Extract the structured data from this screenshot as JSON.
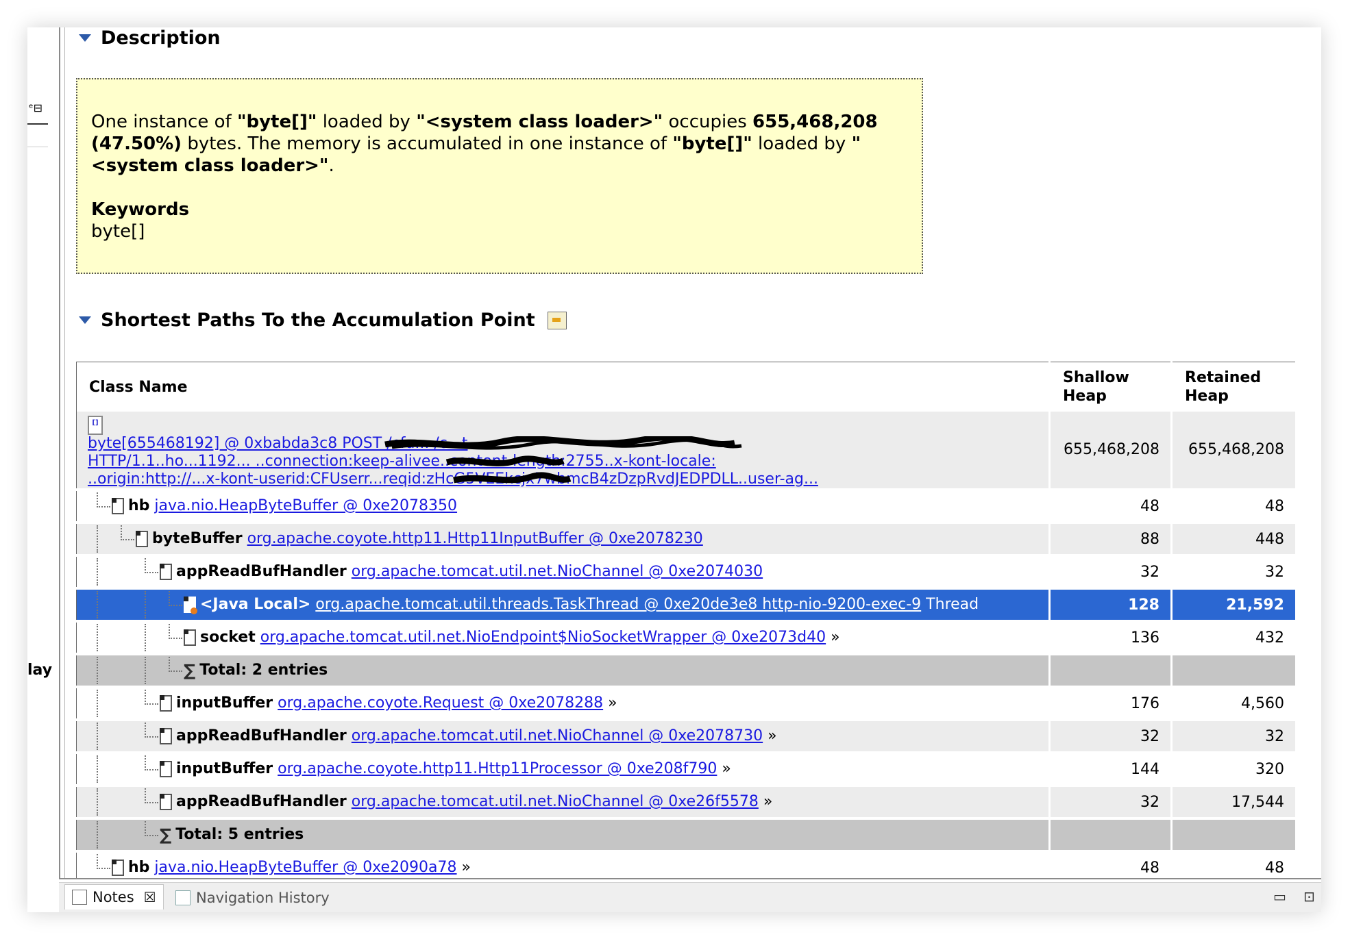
{
  "sidebar": {
    "fragment_icon": "ᵉ⊟",
    "fragment_text": "lay"
  },
  "description": {
    "title": "Description",
    "p1": "One instance of ",
    "p1_b1": "\"byte[]\"",
    "p1_t2": " loaded by ",
    "p1_b2": "\"<system class loader>\"",
    "p1_t3": " occupies ",
    "p1_b3": "655,468,208 (47.50%)",
    "p1_t4": " bytes. The memory is accumulated in one instance of ",
    "p1_b4": "\"byte[]\"",
    "p1_t5": " loaded by ",
    "p1_b5": "\"<system class loader>\"",
    "p1_t6": ".",
    "keywords_label": "Keywords",
    "keywords_value": "byte[]"
  },
  "paths": {
    "title": "Shortest Paths To the Accumulation Point"
  },
  "table": {
    "headers": {
      "class_name": "Class Name",
      "shallow": "Shallow Heap",
      "retained": "Retained Heap"
    },
    "root": {
      "line1": "byte[655468192] @ 0xbabda3c8 POST /cfu... /c...t",
      "line2": "HTTP/1.1..ho...1192... ..connection:keep-alivee..content-length:2755..x-kont-locale:",
      "line3": "..origin:http://...x-kont-userid:CFUserr...reqid:zHcG5VEEkcjx7wbmcB4zDzpRvdJEDPDLL..user-ag...",
      "shallow": "655,468,208",
      "retained": "655,468,208"
    },
    "rows": [
      {
        "field": "hb",
        "link": "java.nio.HeapByteBuffer @ 0xe2078350",
        "suffix": "",
        "shallow": "48",
        "retained": "48"
      },
      {
        "field": "byteBuffer",
        "link": "org.apache.coyote.http11.Http11InputBuffer @ 0xe2078230",
        "suffix": "",
        "shallow": "88",
        "retained": "448"
      },
      {
        "field": "appReadBufHandler",
        "link": "org.apache.tomcat.util.net.NioChannel @ 0xe2074030",
        "suffix": "",
        "shallow": "32",
        "retained": "32"
      },
      {
        "field": "<Java Local>",
        "link": "org.apache.tomcat.util.threads.TaskThread @ 0xe20de3e8 http-nio-9200-exec-9",
        "suffix": " Thread",
        "shallow": "128",
        "retained": "21,592"
      },
      {
        "field": "socket",
        "link": "org.apache.tomcat.util.net.NioEndpoint$NioSocketWrapper @ 0xe2073d40",
        "suffix": " »",
        "shallow": "136",
        "retained": "432"
      },
      {
        "field": "Total: 2 entries",
        "link": "",
        "suffix": "",
        "shallow": "",
        "retained": ""
      },
      {
        "field": "inputBuffer",
        "link": "org.apache.coyote.Request @ 0xe2078288",
        "suffix": " »",
        "shallow": "176",
        "retained": "4,560"
      },
      {
        "field": "appReadBufHandler",
        "link": "org.apache.tomcat.util.net.NioChannel @ 0xe2078730",
        "suffix": " »",
        "shallow": "32",
        "retained": "32"
      },
      {
        "field": "inputBuffer",
        "link": "org.apache.coyote.http11.Http11Processor @ 0xe208f790",
        "suffix": " »",
        "shallow": "144",
        "retained": "320"
      },
      {
        "field": "appReadBufHandler",
        "link": "org.apache.tomcat.util.net.NioChannel @ 0xe26f5578",
        "suffix": " »",
        "shallow": "32",
        "retained": "17,544"
      },
      {
        "field": "Total: 5 entries",
        "link": "",
        "suffix": "",
        "shallow": "",
        "retained": ""
      },
      {
        "field": "hb",
        "link": "java.nio.HeapByteBuffer @ 0xe2090a78",
        "suffix": " »",
        "shallow": "48",
        "retained": "48"
      }
    ]
  },
  "bottom_tabs": {
    "notes": "Notes",
    "navigation": "Navigation History",
    "minimize": "▭",
    "maximize": "⊡"
  },
  "colors": {
    "selection": "#2b67d2",
    "link": "#1a1ae0",
    "desc_bg": "#ffffcc"
  }
}
